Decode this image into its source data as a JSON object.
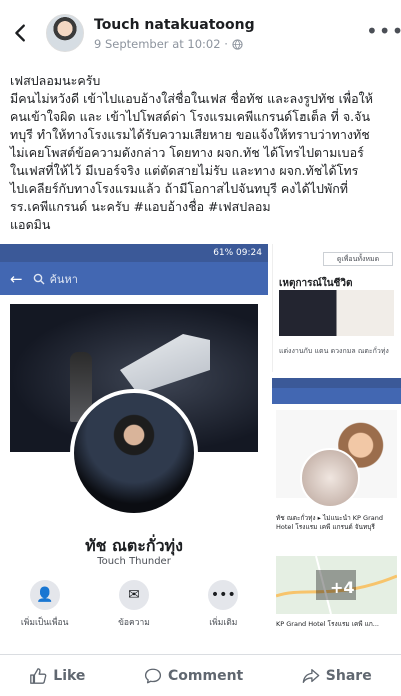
{
  "header": {
    "author": "Touch natakuatoong",
    "timestamp": "9 September at 10:02 ·"
  },
  "post": {
    "lines": [
      "เฟสปลอมนะครับ",
      "มีคนไม่หวังดี เข้าไปแอบอ้างใส่ชื่อในเฟส ชื่อทัช และลงรูปทัช เพื่อให้",
      "คนเข้าใจผิด และ เข้าไปโพสด์ด่า โรงแรมเคพีแกรนด์โฮเต็ล ที่ จ.จัน",
      "ทบุรี ทำให้ทางโรงแรมได้รับความเสียหาย ขอแจ้งให้ทราบว่าทางทัช",
      "ไม่เคยโพสต์ข้อความดังกล่าว โดยทาง ผจก.ทัช ได้โทรไปตามเบอร์",
      "ในเฟสที่ให้ไว้ มีเบอร์จริง แต่ตัดสายไม่รับ และทาง ผจก.ทัชได้โทร",
      "ไปเคลียร์กับทางโรงแรมแล้ว ถ้ามีโอกาสไปจันทบุรี คงได้ไปพักที่",
      "รร.เคพีแกรนด์ นะครับ #แอบอ้างชื่อ #เฟสปลอม",
      "แอดมิน"
    ]
  },
  "left_image": {
    "status": "61% 09:24",
    "search_placeholder": "ค้นหา",
    "profile_name": "ทัช ณตะกั่วทุ่ง",
    "profile_subtitle": "Touch Thunder",
    "actions": [
      "เพิ่มเป็นเพื่อน",
      "ข้อความ",
      "เพิ่มเติม"
    ]
  },
  "right_top_image": {
    "see_all": "ดูเพื่อนทั้งหมด",
    "life_title": "เหตุการณ์ในชีวิต",
    "life_caption": "แต่งงานกับ แตน ดวงกมล ณตะกั่วทุ่ง"
  },
  "right_bottom_image": {
    "post_snippet": "ทัช ณตะกั่วทุ่ง ▸ ไม่แนะนำ KP Grand Hotel โรงแรม เคพี แกรนด์ จันทบุรี",
    "plus_count": "+4",
    "hotel": "KP Grand Hotel โรงแรม เคพี แก..."
  },
  "footer": {
    "like": "Like",
    "comment": "Comment",
    "share": "Share"
  }
}
